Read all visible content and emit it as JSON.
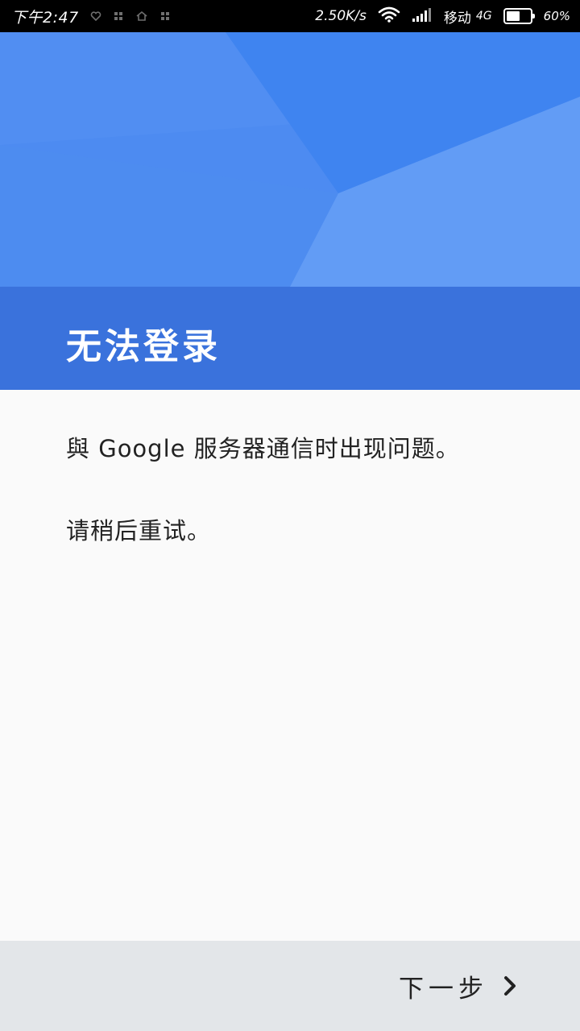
{
  "status_bar": {
    "time": "下午2:47",
    "network_speed": "2.50K/s",
    "carrier": "移动",
    "network_type": "4G",
    "battery_level": 60,
    "battery_text": "60%"
  },
  "page": {
    "title": "无法登录",
    "message_line1": "與 Google 服务器通信时出现问题。",
    "message_line2": "请稍后重试。"
  },
  "footer": {
    "next_label": "下一步"
  },
  "colors": {
    "hero_blue": "#4a89f0",
    "title_band_blue": "#3a72dc",
    "background": "#fafafa",
    "footer_gray": "#e3e6e9",
    "text_dark": "#222222"
  },
  "icons": {
    "next": "chevron-right-icon",
    "wifi": "wifi-icon",
    "signal": "signal-icon",
    "battery": "battery-icon"
  }
}
